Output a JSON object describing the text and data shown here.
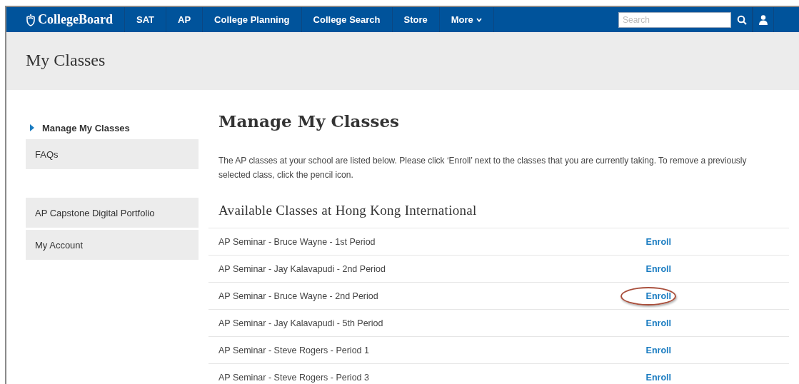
{
  "navbar": {
    "logo": "CollegeBoard",
    "items": [
      {
        "label": "SAT",
        "kind": "link"
      },
      {
        "label": "AP",
        "kind": "link"
      },
      {
        "label": "College Planning",
        "kind": "link"
      },
      {
        "label": "College Search",
        "kind": "link"
      },
      {
        "label": "Store",
        "kind": "link"
      },
      {
        "label": "More",
        "kind": "dropdown"
      }
    ],
    "search": {
      "placeholder": "Search"
    }
  },
  "page_title": "My Classes",
  "sidebar": {
    "sections": [
      {
        "items": [
          {
            "label": "Manage My Classes",
            "selected": true
          },
          {
            "label": "FAQs",
            "selected": false
          }
        ]
      },
      {
        "items": [
          {
            "label": "AP Capstone Digital Portfolio",
            "selected": false
          },
          {
            "label": "My Account",
            "selected": false
          }
        ]
      }
    ]
  },
  "main": {
    "heading": "Manage My Classes",
    "intro": "The AP classes at your school are listed below. Please click ‘Enroll’ next to the classes that you are currently taking. To remove a previously selected class, click the pencil icon.",
    "subheading": "Available Classes at Hong Kong International",
    "classes": [
      {
        "name": "AP Seminar - Bruce Wayne - 1st Period",
        "action": "Enroll",
        "circled": false
      },
      {
        "name": "AP Seminar - Jay Kalavapudi - 2nd Period",
        "action": "Enroll",
        "circled": false
      },
      {
        "name": "AP Seminar - Bruce Wayne - 2nd Period",
        "action": "Enroll",
        "circled": true
      },
      {
        "name": "AP Seminar - Jay Kalavapudi - 5th Period",
        "action": "Enroll",
        "circled": false
      },
      {
        "name": "AP Seminar - Steve Rogers - Period 1",
        "action": "Enroll",
        "circled": false
      },
      {
        "name": "AP Seminar - Steve Rogers - Period 3",
        "action": "Enroll",
        "circled": false
      }
    ]
  }
}
